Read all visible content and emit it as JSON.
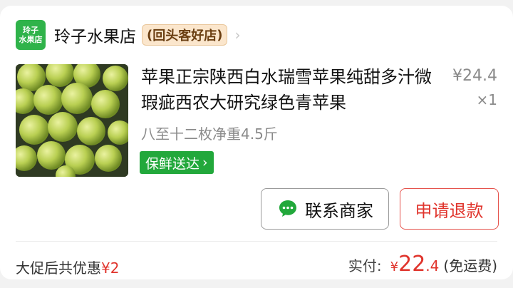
{
  "store": {
    "logo_line1": "玲子",
    "logo_line2": "水果店",
    "name": "玲子水果店",
    "badge": "回头客好店"
  },
  "item": {
    "title": "苹果正宗陕西白水瑞雪苹果纯甜多汁微瑕疵西农大研究绿色青苹果",
    "price": "¥24.4",
    "quantity": "×1",
    "spec": "八至十二枚净重4.5斤",
    "fresh_badge": "保鲜送达",
    "image_icon": "green-apples-photo"
  },
  "actions": {
    "contact_label": "联系商家",
    "refund_label": "申请退款"
  },
  "summary": {
    "discount_label": "大促后共优惠",
    "discount_amount": "¥2",
    "paid_label": "实付:",
    "paid_symbol": "¥",
    "paid_int": "22",
    "paid_dec": ".4",
    "shipping": "(免运费)"
  },
  "colors": {
    "accent_green": "#22a83b",
    "price_red": "#e0342c"
  }
}
